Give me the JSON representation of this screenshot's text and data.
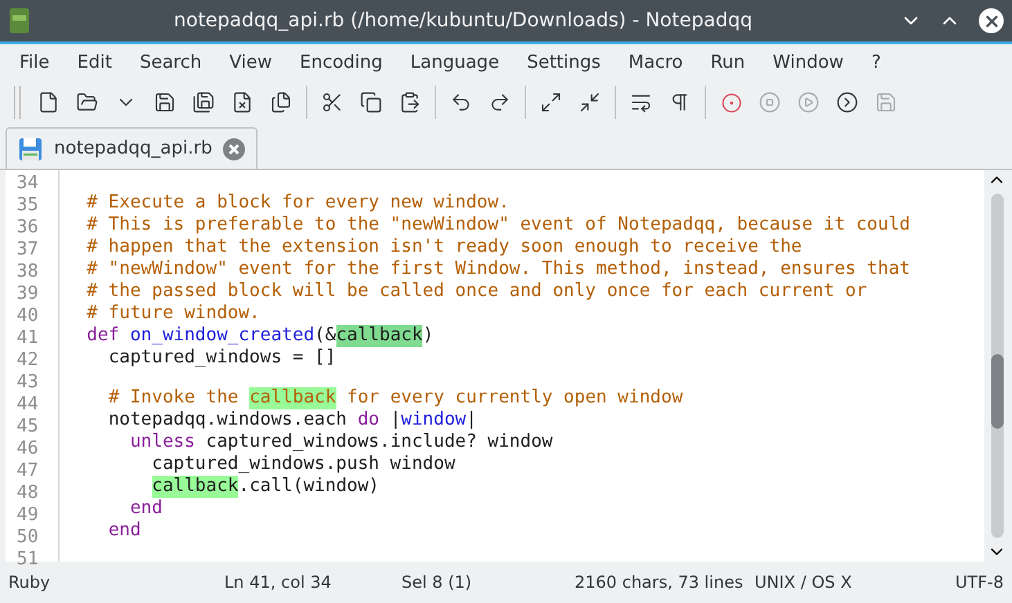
{
  "window": {
    "title": "notepadqq_api.rb (/home/kubuntu/Downloads) - Notepadqq"
  },
  "menu": [
    "File",
    "Edit",
    "Search",
    "View",
    "Encoding",
    "Language",
    "Settings",
    "Macro",
    "Run",
    "Window",
    "?"
  ],
  "toolbar": {
    "groups": [
      {
        "buttons": [
          {
            "disabled": false
          },
          {
            "disabled": false
          },
          {
            "disabled": false
          },
          {
            "disabled": false
          },
          {
            "disabled": false
          },
          {
            "disabled": false
          },
          {
            "disabled": false
          }
        ]
      },
      {
        "buttons": [
          {
            "disabled": false
          },
          {
            "disabled": false
          },
          {
            "disabled": false
          }
        ]
      },
      {
        "buttons": [
          {
            "disabled": false
          },
          {
            "disabled": false
          }
        ]
      },
      {
        "buttons": [
          {
            "disabled": false
          },
          {
            "disabled": false
          }
        ]
      },
      {
        "buttons": [
          {
            "disabled": false
          },
          {
            "disabled": false
          }
        ]
      },
      {
        "buttons": [
          {
            "disabled": false
          },
          {
            "disabled": true
          },
          {
            "disabled": true
          },
          {
            "disabled": false
          },
          {
            "disabled": true
          }
        ]
      }
    ]
  },
  "tabs": [
    {
      "label": "notepadqq_api.rb",
      "selected": true
    }
  ],
  "editor": {
    "lines": [
      {
        "number": "34"
      },
      {
        "number": "35",
        "tokens": [
          {
            "text": "  # Execute a block for every new window.",
            "kind": "comment"
          }
        ]
      },
      {
        "number": "36",
        "tokens": [
          {
            "text": "  # This is preferable to the \"newWindow\" event of Notepadqq, because it could",
            "kind": "comment"
          }
        ]
      },
      {
        "number": "37",
        "tokens": [
          {
            "text": "  # happen that the extension isn't ready soon enough to receive the",
            "kind": "comment"
          }
        ]
      },
      {
        "number": "38",
        "tokens": [
          {
            "text": "  # \"newWindow\" event for the first Window. This method, instead, ensures that",
            "kind": "comment"
          }
        ]
      },
      {
        "number": "39",
        "tokens": [
          {
            "text": "  # the passed block will be called once and only once for each current or",
            "kind": "comment"
          }
        ]
      },
      {
        "number": "40",
        "tokens": [
          {
            "text": "  # future window.",
            "kind": "comment"
          }
        ]
      },
      {
        "number": "41",
        "tokens": [
          {
            "text": "  def",
            "kind": "keyword"
          },
          {
            "text": " on_window_created",
            "kind": "method"
          },
          {
            "text": "(&",
            "kind": "plain"
          },
          {
            "text": "callback",
            "kind": "selection"
          },
          {
            "text": ")",
            "kind": "plain"
          }
        ]
      },
      {
        "number": "42",
        "tokens": [
          {
            "text": "    captured_windows = []",
            "kind": "plain"
          }
        ]
      },
      {
        "number": "43"
      },
      {
        "number": "44",
        "tokens": [
          {
            "text": "    # Invoke the ",
            "kind": "comment"
          },
          {
            "text": "callback",
            "kind": "match-comment"
          },
          {
            "text": " for every currently open window",
            "kind": "comment"
          }
        ]
      },
      {
        "number": "45",
        "tokens": [
          {
            "text": "    notepadqq.windows.each ",
            "kind": "plain"
          },
          {
            "text": "do",
            "kind": "keyword"
          },
          {
            "text": " |",
            "kind": "plain"
          },
          {
            "text": "window",
            "kind": "method"
          },
          {
            "text": "|",
            "kind": "plain"
          }
        ]
      },
      {
        "number": "46",
        "tokens": [
          {
            "text": "      unless",
            "kind": "keyword"
          },
          {
            "text": " captured_windows.include? window",
            "kind": "plain"
          }
        ]
      },
      {
        "number": "47",
        "tokens": [
          {
            "text": "        captured_windows.push window",
            "kind": "plain"
          }
        ]
      },
      {
        "number": "48",
        "tokens": [
          {
            "text": "        callback",
            "kind": "match"
          },
          {
            "text": ".call(window)",
            "kind": "plain"
          }
        ]
      },
      {
        "number": "49",
        "tokens": [
          {
            "text": "      end",
            "kind": "keyword"
          }
        ]
      },
      {
        "number": "50",
        "tokens": [
          {
            "text": "    end",
            "kind": "keyword"
          }
        ]
      },
      {
        "number": "51"
      }
    ]
  },
  "status_bar": {
    "language": "Ruby",
    "position": "Ln 41, col 34",
    "selection": "Sel 8 (1)",
    "stats": "2160 chars, 73 lines",
    "line_endings": "UNIX / OS X",
    "encoding": "UTF-8"
  }
}
